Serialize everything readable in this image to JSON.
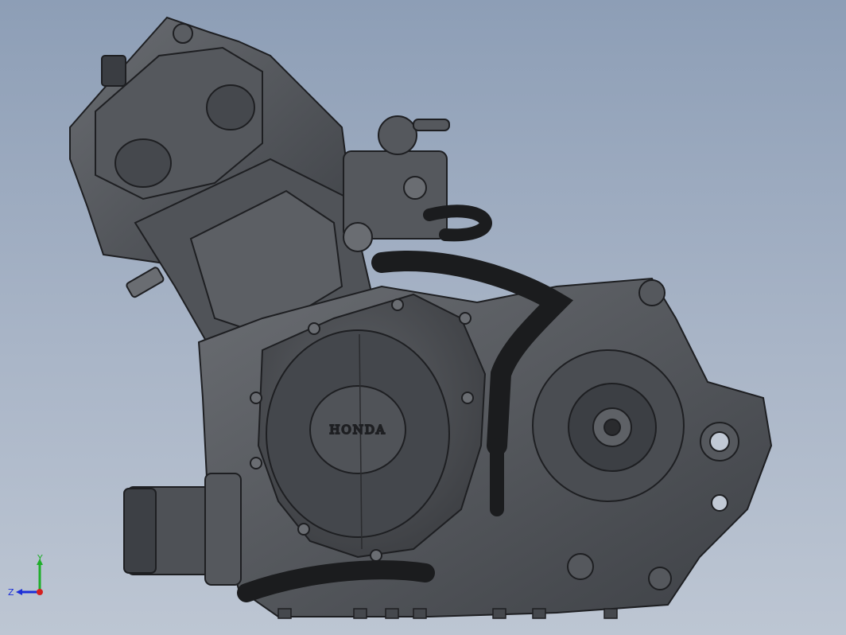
{
  "viewport": {
    "background_top": "#8d9eb6",
    "background_bottom": "#bdc6d3"
  },
  "model": {
    "cover_logo_text": "HONDA",
    "body_color": "#4a4d52",
    "edge_color": "#1e1f22",
    "hose_color": "#1b1c1e"
  },
  "triad": {
    "x_label": "",
    "y_label": "Y",
    "z_label": "Z",
    "y_axis_color": "#1fae2a",
    "z_axis_color": "#1c2fd8",
    "x_axis_color": "#d42020"
  }
}
